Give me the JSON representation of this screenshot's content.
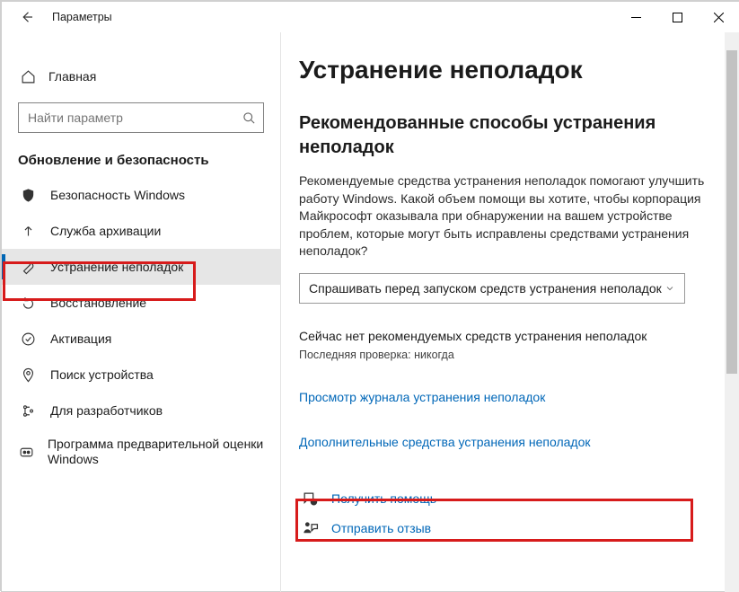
{
  "window": {
    "title": "Параметры"
  },
  "sidebar": {
    "home_label": "Главная",
    "search_placeholder": "Найти параметр",
    "group_header": "Обновление и безопасность",
    "items": [
      {
        "label": "Безопасность Windows"
      },
      {
        "label": "Служба архивации"
      },
      {
        "label": "Устранение неполадок",
        "active": true
      },
      {
        "label": "Восстановление"
      },
      {
        "label": "Активация"
      },
      {
        "label": "Поиск устройства"
      },
      {
        "label": "Для разработчиков"
      },
      {
        "label": "Программа предварительной оценки Windows"
      }
    ]
  },
  "main": {
    "page_title": "Устранение неполадок",
    "section_title": "Рекомендованные способы устранения неполадок",
    "intro_text": "Рекомендуемые средства устранения неполадок помогают улучшить работу Windows. Какой объем помощи вы хотите, чтобы корпорация Майкрософт оказывала при обнаружении на вашем устройстве проблем, которые могут быть исправлены средствами устранения неполадок?",
    "dropdown_value": "Спрашивать перед запуском средств устранения неполадок",
    "status_main": "Сейчас нет рекомендуемых средств устранения неполадок",
    "status_last_check": "Последняя проверка: никогда",
    "link_history": "Просмотр журнала устранения неполадок",
    "link_more_tools": "Дополнительные средства устранения неполадок",
    "footer": {
      "get_help": "Получить помощь",
      "feedback": "Отправить отзыв"
    }
  }
}
